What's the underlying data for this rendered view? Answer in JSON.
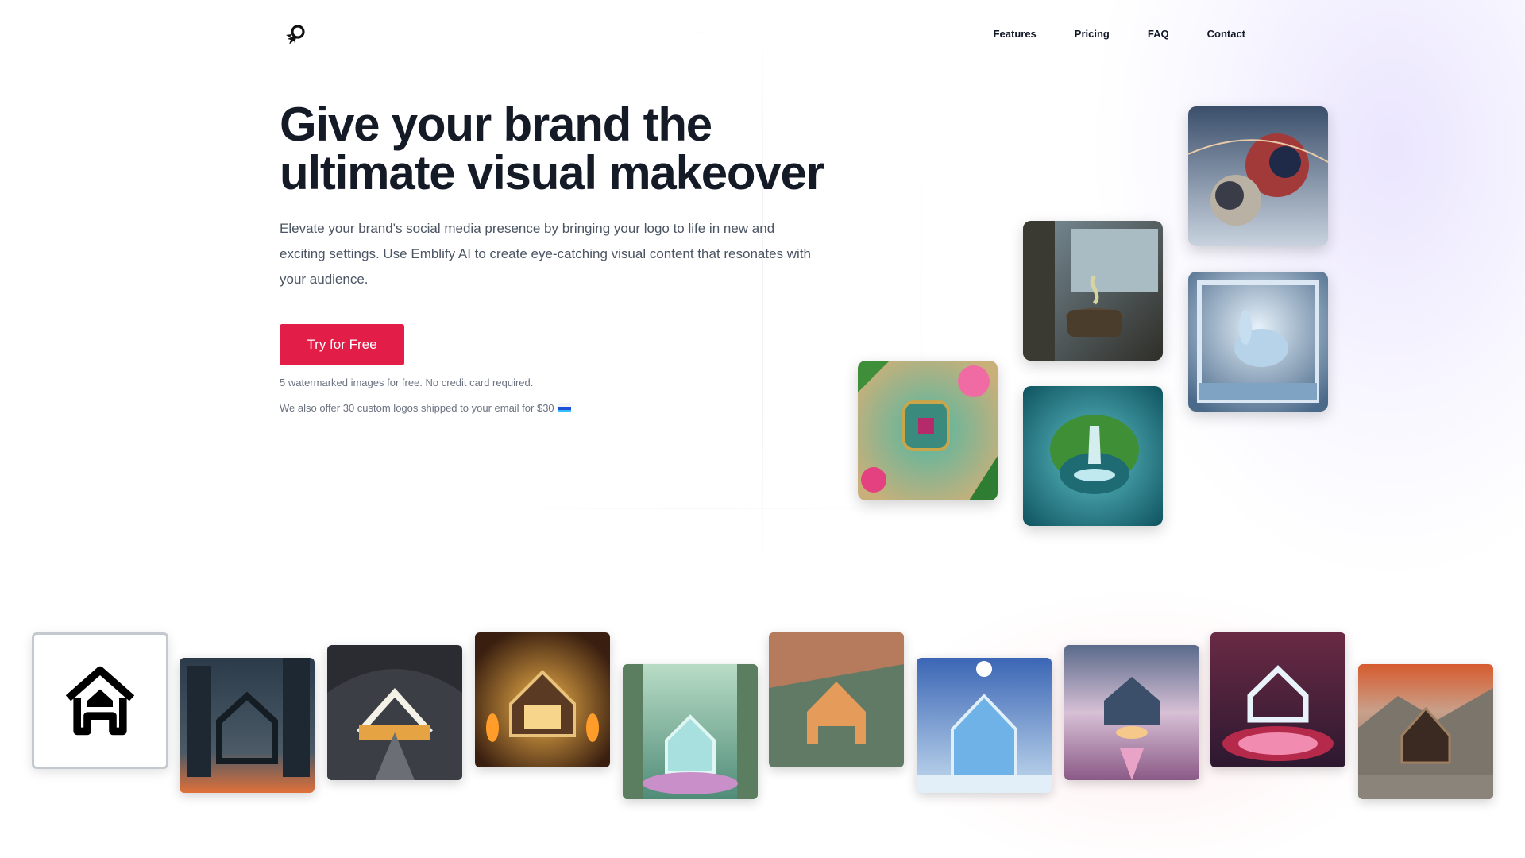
{
  "nav": {
    "logo_icon": "rocket-logo-icon",
    "items": [
      {
        "label": "Features"
      },
      {
        "label": "Pricing"
      },
      {
        "label": "FAQ"
      },
      {
        "label": "Contact"
      }
    ]
  },
  "hero": {
    "title_line1": "Give your brand the",
    "title_line2": "ultimate visual makeover",
    "subtitle": "Elevate your brand's social media presence by bringing your logo to life in new and exciting settings. Use Emblify AI to create eye-catching visual content that resonates with your audience.",
    "cta_label": "Try for Free",
    "note_free": "5 watermarked images for free. No credit card required.",
    "note_offer": "We also offer 30 custom logos shipped to your email for $30",
    "note_offer_icon": "ship-icon"
  },
  "colors": {
    "accent": "#e11d48",
    "heading": "#141a26",
    "body_text": "#4b5563"
  },
  "gallery": {
    "hero_images": [
      {
        "icon": "tropical-chip-image"
      },
      {
        "icon": "coffee-cup-window-image"
      },
      {
        "icon": "island-waterfall-image"
      },
      {
        "icon": "planets-sky-image"
      },
      {
        "icon": "crystal-rabbit-frame-image"
      }
    ],
    "strip_images": [
      {
        "icon": "house-logo-original"
      },
      {
        "icon": "city-sunset-house-image"
      },
      {
        "icon": "subway-tunnel-house-image"
      },
      {
        "icon": "cabin-fireplace-house-image"
      },
      {
        "icon": "forest-light-house-image"
      },
      {
        "icon": "aerial-city-house-image"
      },
      {
        "icon": "ice-crystal-house-image"
      },
      {
        "icon": "blossom-valley-house-image"
      },
      {
        "icon": "stadium-house-image"
      },
      {
        "icon": "mountain-temple-house-image"
      }
    ]
  }
}
